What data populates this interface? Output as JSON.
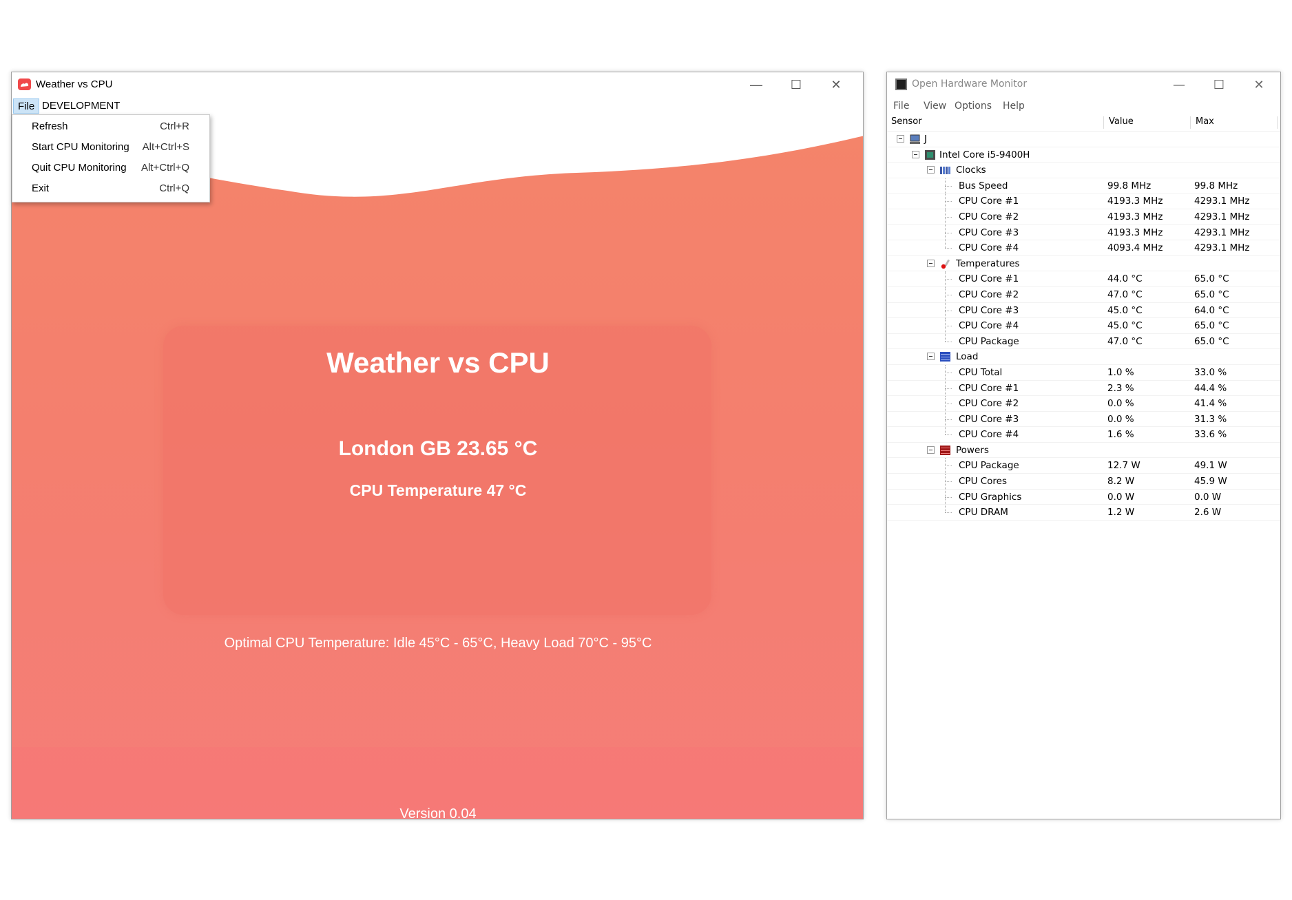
{
  "weather_app": {
    "title": "Weather vs CPU",
    "menubar": [
      {
        "label": "File"
      },
      {
        "label": "DEVELOPMENT"
      }
    ],
    "file_menu": [
      {
        "label": "Refresh",
        "shortcut": "Ctrl+R"
      },
      {
        "label": "Start CPU Monitoring",
        "shortcut": "Alt+Ctrl+S"
      },
      {
        "label": "Quit CPU Monitoring",
        "shortcut": "Alt+Ctrl+Q"
      },
      {
        "label": "Exit",
        "shortcut": "Ctrl+Q"
      }
    ],
    "heading": "Weather vs CPU",
    "city_line": "London GB 23.65 °C",
    "cpu_line": "CPU Temperature 47 °C",
    "optimal": "Optimal CPU Temperature: Idle 45°C - 65°C, Heavy Load 70°C - 95°C",
    "version": "Version 0.04",
    "colors": {
      "accent": "#f4806e",
      "logo": "#f0484a"
    }
  },
  "ohm": {
    "title": "Open Hardware Monitor",
    "menu": [
      "File",
      "View",
      "Options",
      "Help"
    ],
    "columns": [
      "Sensor",
      "Value",
      "Max"
    ],
    "computer": "J",
    "cpu": "Intel Core i5-9400H",
    "groups": [
      {
        "name": "Clocks",
        "icon": "clock-icon",
        "rows": [
          {
            "sensor": "Bus Speed",
            "value": "99.8 MHz",
            "max": "99.8 MHz"
          },
          {
            "sensor": "CPU Core #1",
            "value": "4193.3 MHz",
            "max": "4293.1 MHz"
          },
          {
            "sensor": "CPU Core #2",
            "value": "4193.3 MHz",
            "max": "4293.1 MHz"
          },
          {
            "sensor": "CPU Core #3",
            "value": "4193.3 MHz",
            "max": "4293.1 MHz"
          },
          {
            "sensor": "CPU Core #4",
            "value": "4093.4 MHz",
            "max": "4293.1 MHz"
          }
        ]
      },
      {
        "name": "Temperatures",
        "icon": "thermometer-icon",
        "rows": [
          {
            "sensor": "CPU Core #1",
            "value": "44.0 °C",
            "max": "65.0 °C"
          },
          {
            "sensor": "CPU Core #2",
            "value": "47.0 °C",
            "max": "65.0 °C"
          },
          {
            "sensor": "CPU Core #3",
            "value": "45.0 °C",
            "max": "64.0 °C"
          },
          {
            "sensor": "CPU Core #4",
            "value": "45.0 °C",
            "max": "65.0 °C"
          },
          {
            "sensor": "CPU Package",
            "value": "47.0 °C",
            "max": "65.0 °C"
          }
        ]
      },
      {
        "name": "Load",
        "icon": "load-icon",
        "rows": [
          {
            "sensor": "CPU Total",
            "value": "1.0 %",
            "max": "33.0 %"
          },
          {
            "sensor": "CPU Core #1",
            "value": "2.3 %",
            "max": "44.4 %"
          },
          {
            "sensor": "CPU Core #2",
            "value": "0.0 %",
            "max": "41.4 %"
          },
          {
            "sensor": "CPU Core #3",
            "value": "0.0 %",
            "max": "31.3 %"
          },
          {
            "sensor": "CPU Core #4",
            "value": "1.6 %",
            "max": "33.6 %"
          }
        ]
      },
      {
        "name": "Powers",
        "icon": "power-icon",
        "rows": [
          {
            "sensor": "CPU Package",
            "value": "12.7 W",
            "max": "49.1 W"
          },
          {
            "sensor": "CPU Cores",
            "value": "8.2 W",
            "max": "45.9 W"
          },
          {
            "sensor": "CPU Graphics",
            "value": "0.0 W",
            "max": "0.0 W"
          },
          {
            "sensor": "CPU DRAM",
            "value": "1.2 W",
            "max": "2.6 W"
          }
        ]
      }
    ]
  }
}
